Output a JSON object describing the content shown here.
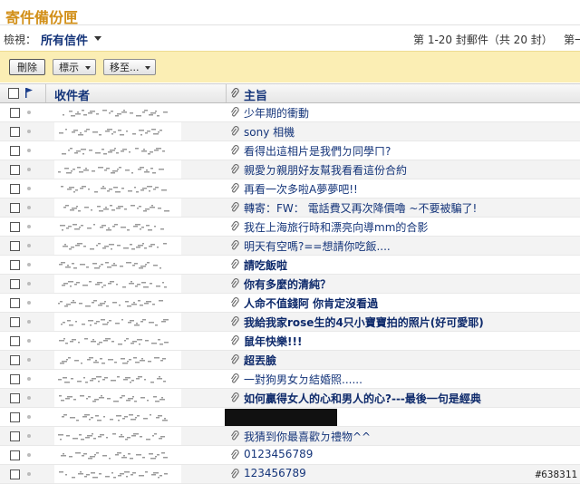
{
  "page": {
    "title": "寄件備份匣"
  },
  "view": {
    "label": "檢視：",
    "selected": "所有信件"
  },
  "paging": {
    "range_text": "第 1-20 封郵件（共 20 封）",
    "first_text": "第一"
  },
  "toolbar": {
    "delete_label": "刪除",
    "mark_label": "標示",
    "move_label": "移至..."
  },
  "table": {
    "sender_header": "收件者",
    "subject_header": "主旨"
  },
  "messages": [
    {
      "subject": "少年期的衝動",
      "unread": false
    },
    {
      "subject": "sony 相機",
      "unread": false
    },
    {
      "subject": "看得出這相片是我們ㄉ同學ㄇ?",
      "unread": false
    },
    {
      "subject": "親愛ㄉ親朋好友幫我看看這份合約",
      "unread": false
    },
    {
      "subject": "再看一次多啦A夢夢吧!!",
      "unread": false
    },
    {
      "subject": "轉寄：FW： 電話費又再次降價嚕 ~不要被騙了!",
      "unread": false
    },
    {
      "subject": "我在上海旅行時和漂亮向導mm的合影",
      "unread": false
    },
    {
      "subject": "明天有空嗎?==想請你吃飯....",
      "unread": false
    },
    {
      "subject": "請吃飯啦",
      "unread": true
    },
    {
      "subject": "你有多麼的清純？",
      "unread": true
    },
    {
      "subject": "人命不值錢阿 你肯定沒看過",
      "unread": true
    },
    {
      "subject": "我給我家rose生的4只小寶寶拍的照片(好可愛耶)",
      "unread": true
    },
    {
      "subject": "鼠年快樂!!!",
      "unread": true
    },
    {
      "subject": "超丟臉",
      "unread": true
    },
    {
      "subject": "一對狗男女ㄉ結婚照......",
      "unread": false
    },
    {
      "subject": "如何贏得女人的心和男人的心?---最後一句是經典",
      "unread": true
    },
    {
      "subject": "",
      "unread": false,
      "redacted": true
    },
    {
      "subject": "我猜到你最喜歡ㄉ禮物^^",
      "unread": false
    },
    {
      "subject": "0123456789",
      "unread": false
    },
    {
      "subject": "123456789",
      "unread": false
    }
  ],
  "watermark": "#638311",
  "icons": {
    "checkbox": "checkbox-icon",
    "flag": "flag-icon",
    "attachment": "paperclip-icon",
    "status": "status-dot-icon"
  },
  "colors": {
    "title": "#d2901a",
    "toolbar_bg": "#fbeeb4",
    "link": "#15357a"
  }
}
